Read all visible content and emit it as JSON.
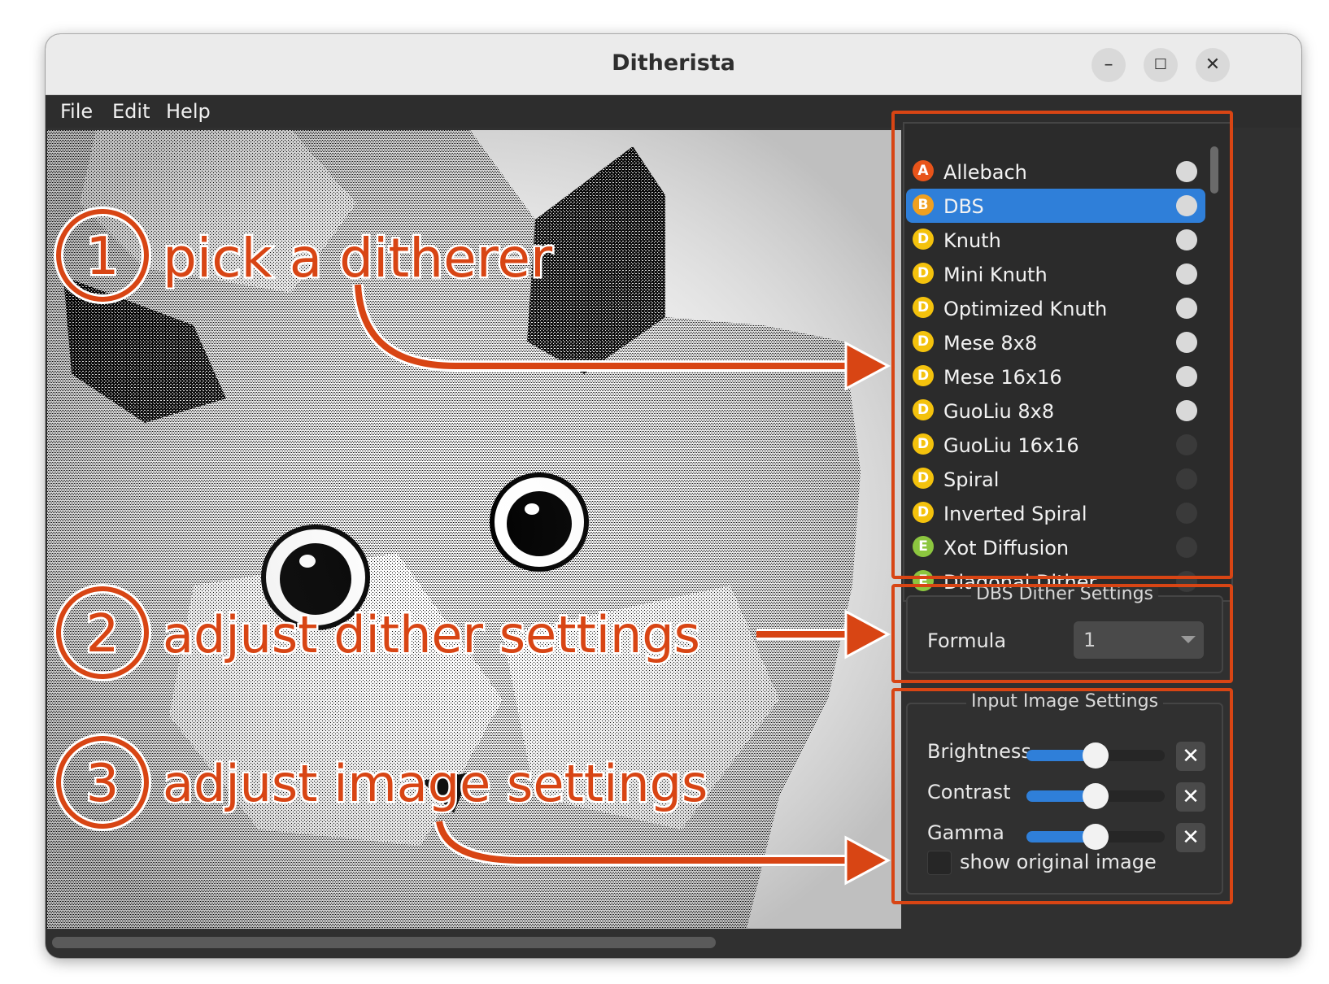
{
  "window": {
    "title": "Ditherista",
    "controls": {
      "minimize": "–",
      "maximize": "☐",
      "close": "✕"
    }
  },
  "menu": {
    "file": "File",
    "edit": "Edit",
    "help": "Help"
  },
  "ditherers": {
    "items": [
      {
        "letter": "A",
        "letter_color": "#e8541a",
        "label": "Allebach",
        "dot": "light"
      },
      {
        "letter": "B",
        "letter_color": "#f0a020",
        "label": "DBS",
        "dot": "light",
        "selected": true
      },
      {
        "letter": "D",
        "letter_color": "#f4c20d",
        "label": "Knuth",
        "dot": "light"
      },
      {
        "letter": "D",
        "letter_color": "#f4c20d",
        "label": "Mini Knuth",
        "dot": "light"
      },
      {
        "letter": "D",
        "letter_color": "#f4c20d",
        "label": "Optimized Knuth",
        "dot": "light"
      },
      {
        "letter": "D",
        "letter_color": "#f4c20d",
        "label": "Mese 8x8",
        "dot": "light"
      },
      {
        "letter": "D",
        "letter_color": "#f4c20d",
        "label": "Mese 16x16",
        "dot": "light"
      },
      {
        "letter": "D",
        "letter_color": "#f4c20d",
        "label": "GuoLiu 8x8",
        "dot": "light"
      },
      {
        "letter": "D",
        "letter_color": "#f4c20d",
        "label": "GuoLiu 16x16",
        "dot": "dark"
      },
      {
        "letter": "D",
        "letter_color": "#f4c20d",
        "label": "Spiral",
        "dot": "dark"
      },
      {
        "letter": "D",
        "letter_color": "#f4c20d",
        "label": "Inverted Spiral",
        "dot": "dark"
      },
      {
        "letter": "E",
        "letter_color": "#8cc63f",
        "label": "Xot Diffusion",
        "dot": "dark"
      },
      {
        "letter": "E",
        "letter_color": "#8cc63f",
        "label": "Diagonal Dither",
        "dot": "dark"
      }
    ]
  },
  "dither_settings": {
    "title": "DBS Dither Settings",
    "formula_label": "Formula",
    "formula_value": "1"
  },
  "image_settings": {
    "title": "Input Image Settings",
    "sliders": [
      {
        "label": "Brightness",
        "value": 0.5
      },
      {
        "label": "Contrast",
        "value": 0.5
      },
      {
        "label": "Gamma",
        "value": 0.5
      }
    ],
    "reset_glyph": "✕",
    "show_original_label": "show original image",
    "show_original_checked": false
  },
  "annotations": {
    "step1_number": "1",
    "step1_text": "pick a ditherer",
    "step2_number": "2",
    "step2_text": "adjust dither settings",
    "step3_number": "3",
    "step3_text": "adjust image settings",
    "accent_color": "#d84514"
  },
  "colors": {
    "selection": "#2f7fd9",
    "panel_bg": "#303030",
    "dot_light": "#d9d9d9",
    "dot_dark": "#3a3a3a"
  }
}
